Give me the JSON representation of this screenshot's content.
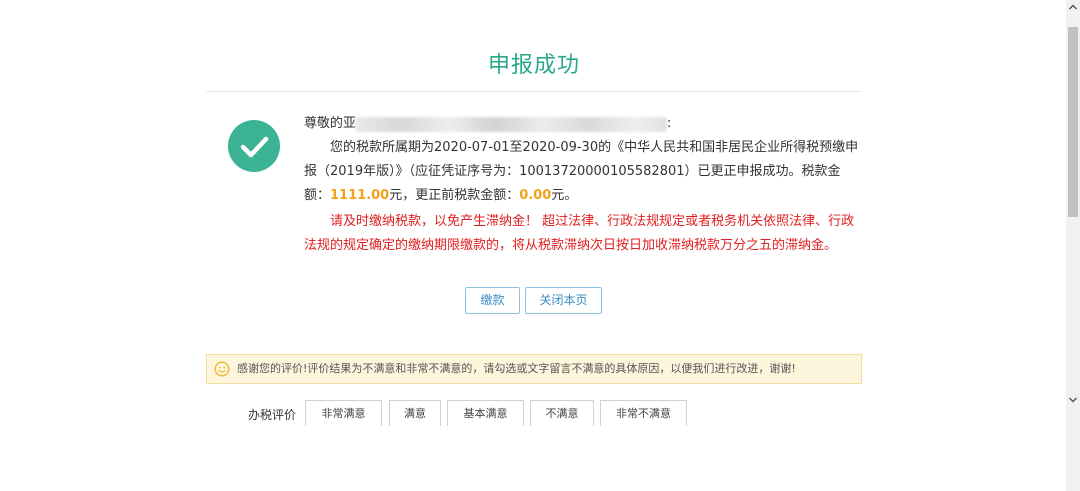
{
  "title": "申报成功",
  "message": {
    "greeting_prefix": "尊敬的亚",
    "greeting_suffix": ":",
    "p1_a": "您的税款所属期为2020-07-01至2020-09-30的《中华人民共和国非居民企业所得税预缴申报（2019年版）》（应征凭证序号为：10013720000105582801）已更正申报成功。税款金额：",
    "tax_amount": "1111.00",
    "p1_b": "元，更正前税款金额：",
    "prev_amount": "0.00",
    "p1_c": "元。",
    "warning": "请及时缴纳税款，以免产生滞纳金！ 超过法律、行政法规规定或者税务机关依照法律、行政法规的规定确定的缴纳期限缴款的，将从税款滞纳次日按日加收滞纳税款万分之五的滞纳金。"
  },
  "buttons": {
    "pay": "缴款",
    "close": "关闭本页"
  },
  "notice": "感谢您的评价!评价结果为不满意和非常不满意的，请勾选或文字留言不满意的具体原因，以便我们进行改进，谢谢!",
  "rating": {
    "label": "办税评价",
    "options": [
      "非常满意",
      "满意",
      "基本满意",
      "不满意",
      "非常不满意"
    ]
  },
  "colors": {
    "title": "#2aa889",
    "check": "#3cb394",
    "amount": "#f5a21a",
    "warning": "#e02020",
    "button_border": "#8cc3e4",
    "notice_bg": "#fdf6dc"
  },
  "icons": [
    "check-circle-icon",
    "smile-icon",
    "scroll-up-icon",
    "scroll-down-icon"
  ]
}
